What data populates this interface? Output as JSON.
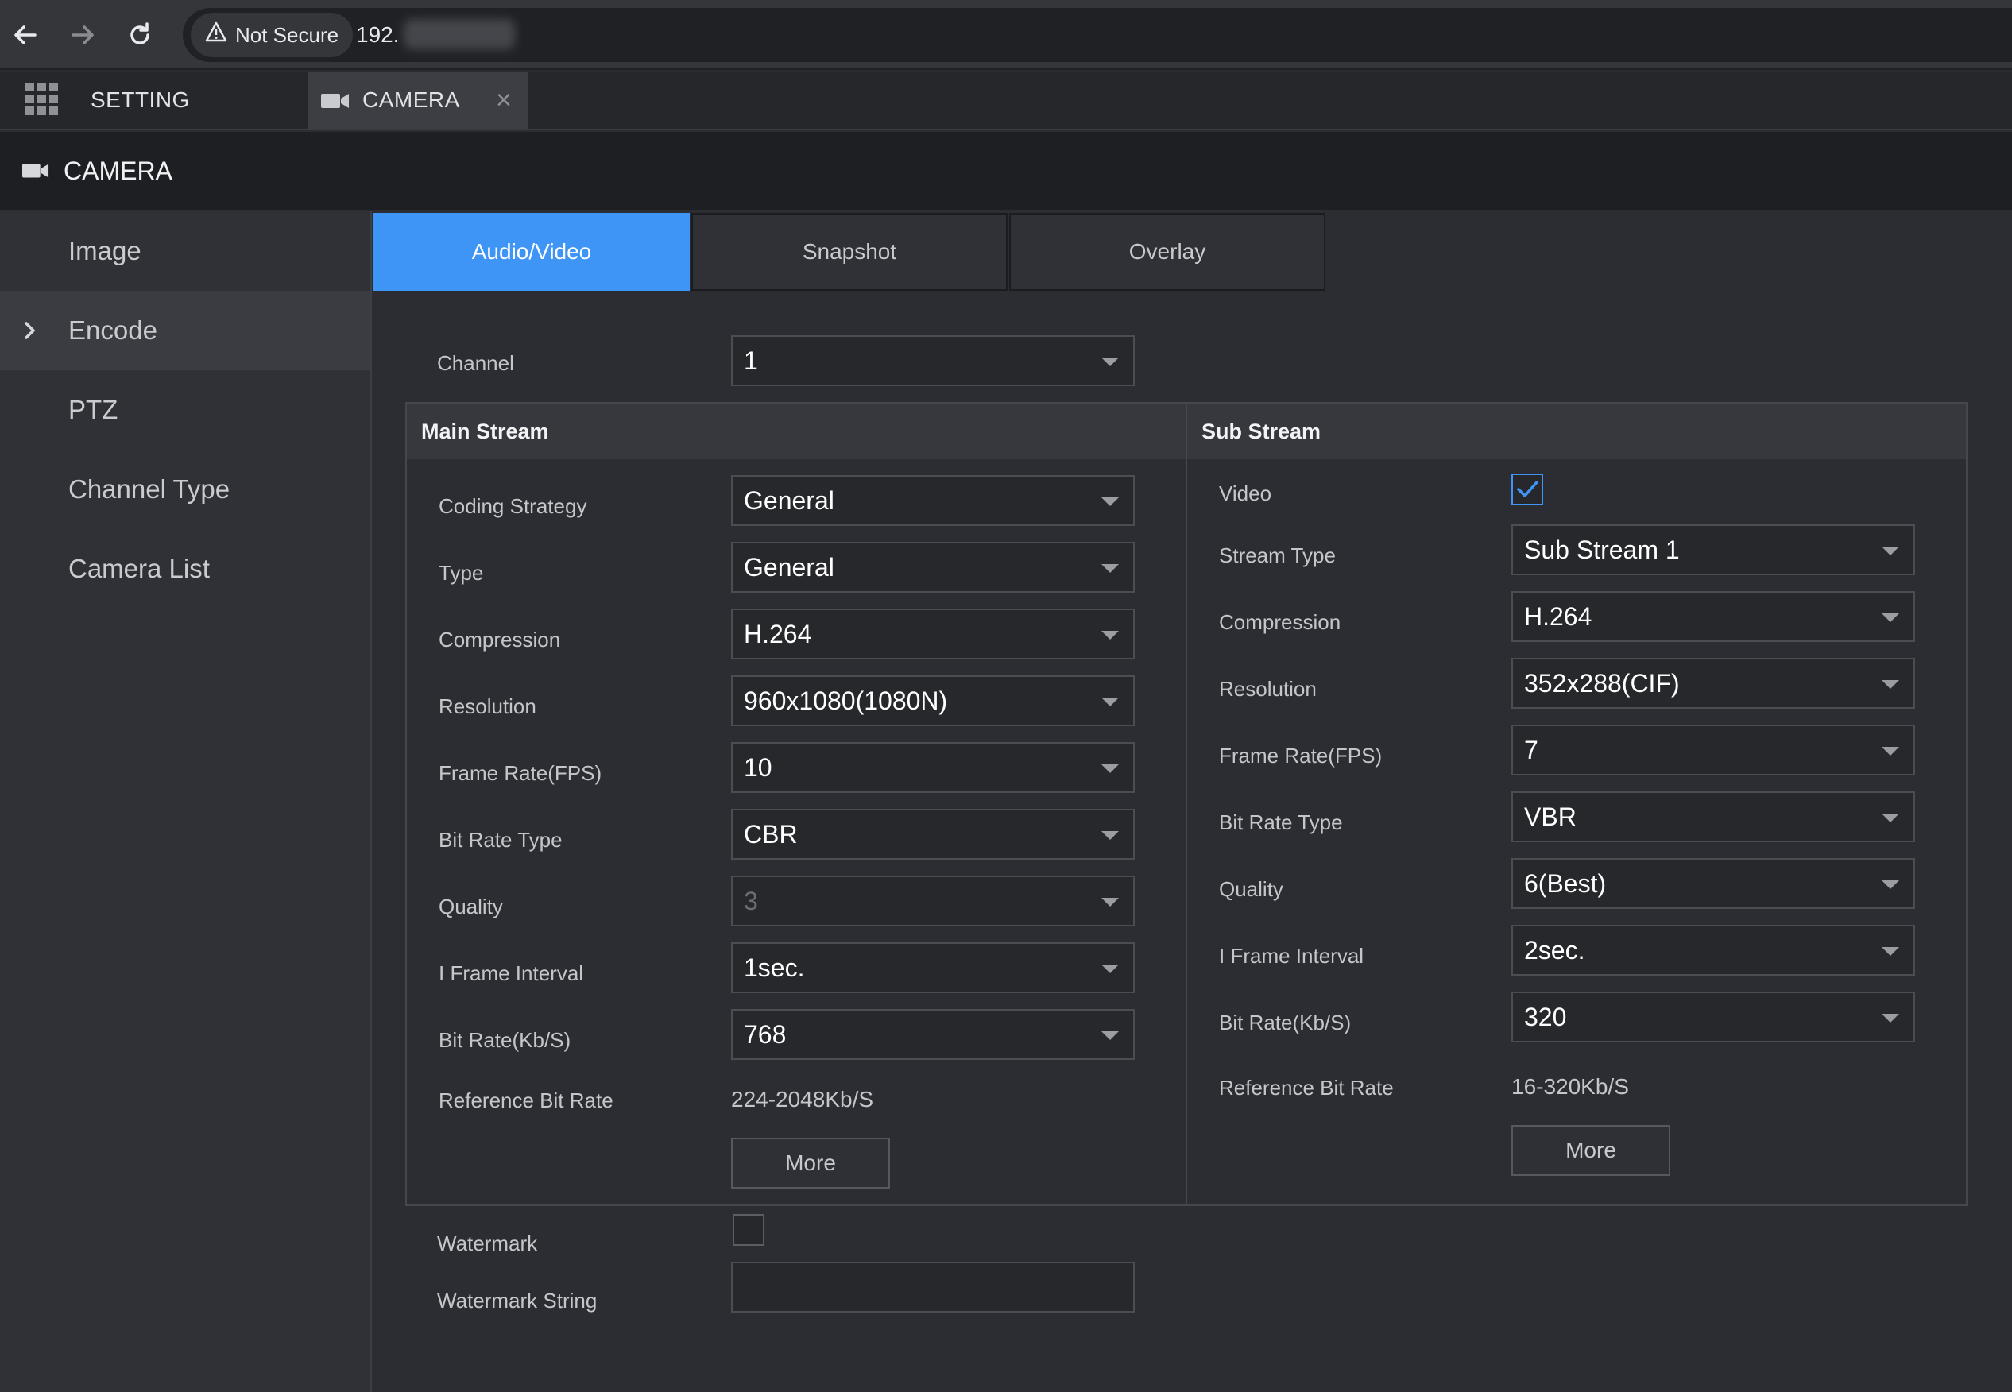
{
  "browser": {
    "security_label": "Not Secure",
    "url_visible": "192."
  },
  "app_tabs": {
    "setting_label": "SETTING",
    "camera_label": "CAMERA",
    "close_glyph": "×"
  },
  "header": {
    "title": "CAMERA"
  },
  "sidebar": {
    "items": [
      {
        "label": "Image"
      },
      {
        "label": "Encode",
        "active": true
      },
      {
        "label": "PTZ"
      },
      {
        "label": "Channel Type"
      },
      {
        "label": "Camera List"
      }
    ]
  },
  "content_tabs": [
    {
      "label": "Audio/Video",
      "active": true
    },
    {
      "label": "Snapshot"
    },
    {
      "label": "Overlay"
    }
  ],
  "channel": {
    "label": "Channel",
    "value": "1"
  },
  "main_stream": {
    "title": "Main Stream",
    "coding_strategy": {
      "label": "Coding Strategy",
      "value": "General"
    },
    "type": {
      "label": "Type",
      "value": "General"
    },
    "compression": {
      "label": "Compression",
      "value": "H.264"
    },
    "resolution": {
      "label": "Resolution",
      "value": "960x1080(1080N)"
    },
    "frame_rate": {
      "label": "Frame Rate(FPS)",
      "value": "10"
    },
    "bit_rate_type": {
      "label": "Bit Rate Type",
      "value": "CBR"
    },
    "quality": {
      "label": "Quality",
      "value": "3",
      "disabled": true
    },
    "i_frame_interval": {
      "label": "I Frame Interval",
      "value": "1sec."
    },
    "bit_rate": {
      "label": "Bit Rate(Kb/S)",
      "value": "768"
    },
    "reference_bit_rate": {
      "label": "Reference Bit Rate",
      "value": "224-2048Kb/S"
    },
    "more_label": "More"
  },
  "sub_stream": {
    "title": "Sub Stream",
    "video": {
      "label": "Video",
      "checked": true
    },
    "stream_type": {
      "label": "Stream Type",
      "value": "Sub Stream 1"
    },
    "compression": {
      "label": "Compression",
      "value": "H.264"
    },
    "resolution": {
      "label": "Resolution",
      "value": "352x288(CIF)"
    },
    "frame_rate": {
      "label": "Frame Rate(FPS)",
      "value": "7"
    },
    "bit_rate_type": {
      "label": "Bit Rate Type",
      "value": "VBR"
    },
    "quality": {
      "label": "Quality",
      "value": "6(Best)"
    },
    "i_frame_interval": {
      "label": "I Frame Interval",
      "value": "2sec."
    },
    "bit_rate": {
      "label": "Bit Rate(Kb/S)",
      "value": "320"
    },
    "reference_bit_rate": {
      "label": "Reference Bit Rate",
      "value": "16-320Kb/S"
    },
    "more_label": "More"
  },
  "watermark": {
    "label": "Watermark",
    "checked": false
  },
  "watermark_string": {
    "label": "Watermark String",
    "value": ""
  },
  "colors": {
    "accent": "#3f95f6",
    "background": "#2b2d32",
    "header": "#1e1f22"
  },
  "icons": [
    "back-arrow-icon",
    "forward-arrow-icon",
    "reload-icon",
    "warning-icon",
    "grid-menu-icon",
    "camera-icon",
    "close-icon",
    "chevron-right-icon",
    "dropdown-caret-icon",
    "checkmark-icon"
  ]
}
